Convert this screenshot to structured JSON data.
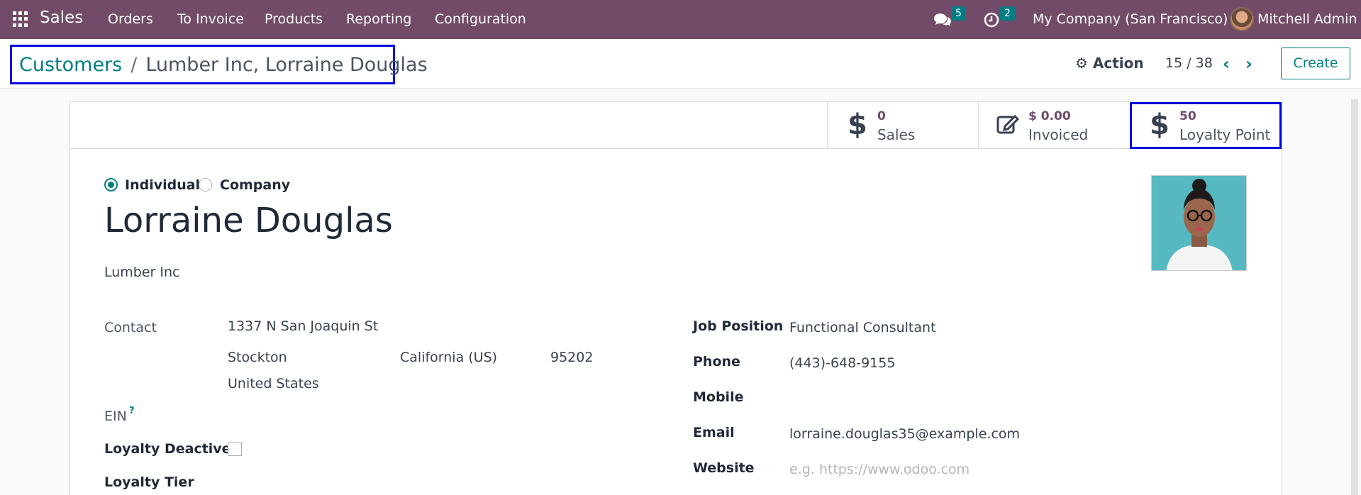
{
  "nav": {
    "app_name": "Sales",
    "menu": [
      "Orders",
      "To Invoice",
      "Products",
      "Reporting",
      "Configuration"
    ],
    "messages_count": "5",
    "activities_count": "2",
    "company": "My Company (San Francisco)",
    "user": "Mitchell Admin"
  },
  "breadcrumb": {
    "parent": "Customers",
    "current": "Lumber Inc, Lorraine Douglas"
  },
  "control": {
    "action_label": "Action",
    "pager": "15 / 38",
    "create_label": "Create"
  },
  "stats": [
    {
      "value": "0",
      "label": "Sales",
      "icon": "dollar-icon"
    },
    {
      "value": "$ 0.00",
      "label": "Invoiced",
      "icon": "edit-icon"
    },
    {
      "value": "50",
      "label": "Loyalty Point",
      "icon": "dollar-icon"
    }
  ],
  "form": {
    "type_individual": "Individual",
    "type_company": "Company",
    "selected_type": "Individual",
    "name": "Lorraine Douglas",
    "company": "Lumber Inc",
    "contact_label": "Contact",
    "street": "1337 N San Joaquin St",
    "city": "Stockton",
    "state": "California (US)",
    "zip": "95202",
    "country": "United States",
    "ein_label": "EIN",
    "ein_help": "?",
    "loyalty_deactive_label": "Loyalty Deactive",
    "loyalty_tier_label": "Loyalty Tier",
    "job_position_label": "Job Position",
    "job_position": "Functional Consultant",
    "phone_label": "Phone",
    "phone": "(443)-648-9155",
    "mobile_label": "Mobile",
    "email_label": "Email",
    "email": "lorraine.douglas35@example.com",
    "website_label": "Website",
    "website_placeholder": "e.g. https://www.odoo.com"
  },
  "colors": {
    "brand": "#714b67",
    "accent": "#017e84",
    "highlight_box": "#0000dd"
  }
}
